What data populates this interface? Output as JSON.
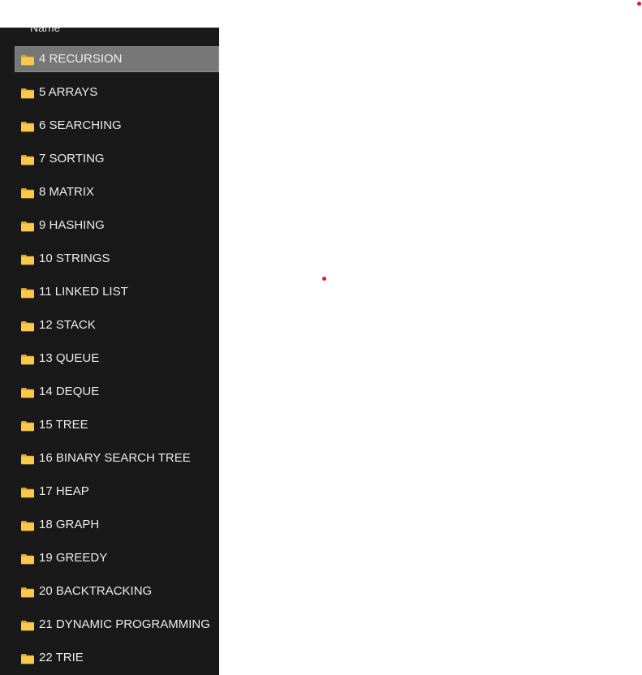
{
  "explorer": {
    "column_header": "Name",
    "selected_index": 0,
    "folders": [
      {
        "label": "4 RECURSION",
        "icon": "folder-icon"
      },
      {
        "label": "5 ARRAYS",
        "icon": "folder-icon"
      },
      {
        "label": "6 SEARCHING",
        "icon": "folder-icon"
      },
      {
        "label": "7 SORTING",
        "icon": "folder-icon"
      },
      {
        "label": "8 MATRIX",
        "icon": "folder-icon"
      },
      {
        "label": "9 HASHING",
        "icon": "folder-icon"
      },
      {
        "label": "10 STRINGS",
        "icon": "folder-icon"
      },
      {
        "label": "11 LINKED LIST",
        "icon": "folder-icon"
      },
      {
        "label": "12 STACK",
        "icon": "folder-icon"
      },
      {
        "label": "13 QUEUE",
        "icon": "folder-icon"
      },
      {
        "label": "14 DEQUE",
        "icon": "folder-icon"
      },
      {
        "label": "15 TREE",
        "icon": "folder-icon"
      },
      {
        "label": "16 BINARY SEARCH TREE",
        "icon": "folder-icon"
      },
      {
        "label": "17 HEAP",
        "icon": "folder-icon"
      },
      {
        "label": "18 GRAPH",
        "icon": "folder-icon"
      },
      {
        "label": "19 GREEDY",
        "icon": "folder-icon"
      },
      {
        "label": "20 BACKTRACKING",
        "icon": "folder-icon"
      },
      {
        "label": "21 DYNAMIC PROGRAMMING",
        "icon": "folder-icon"
      },
      {
        "label": "22 TRIE",
        "icon": "folder-icon"
      }
    ]
  },
  "colors": {
    "panel_background": "#191919",
    "selected_row": "#777777",
    "folder_yellow": "#f8c94a",
    "marker_red": "#e01b24"
  }
}
